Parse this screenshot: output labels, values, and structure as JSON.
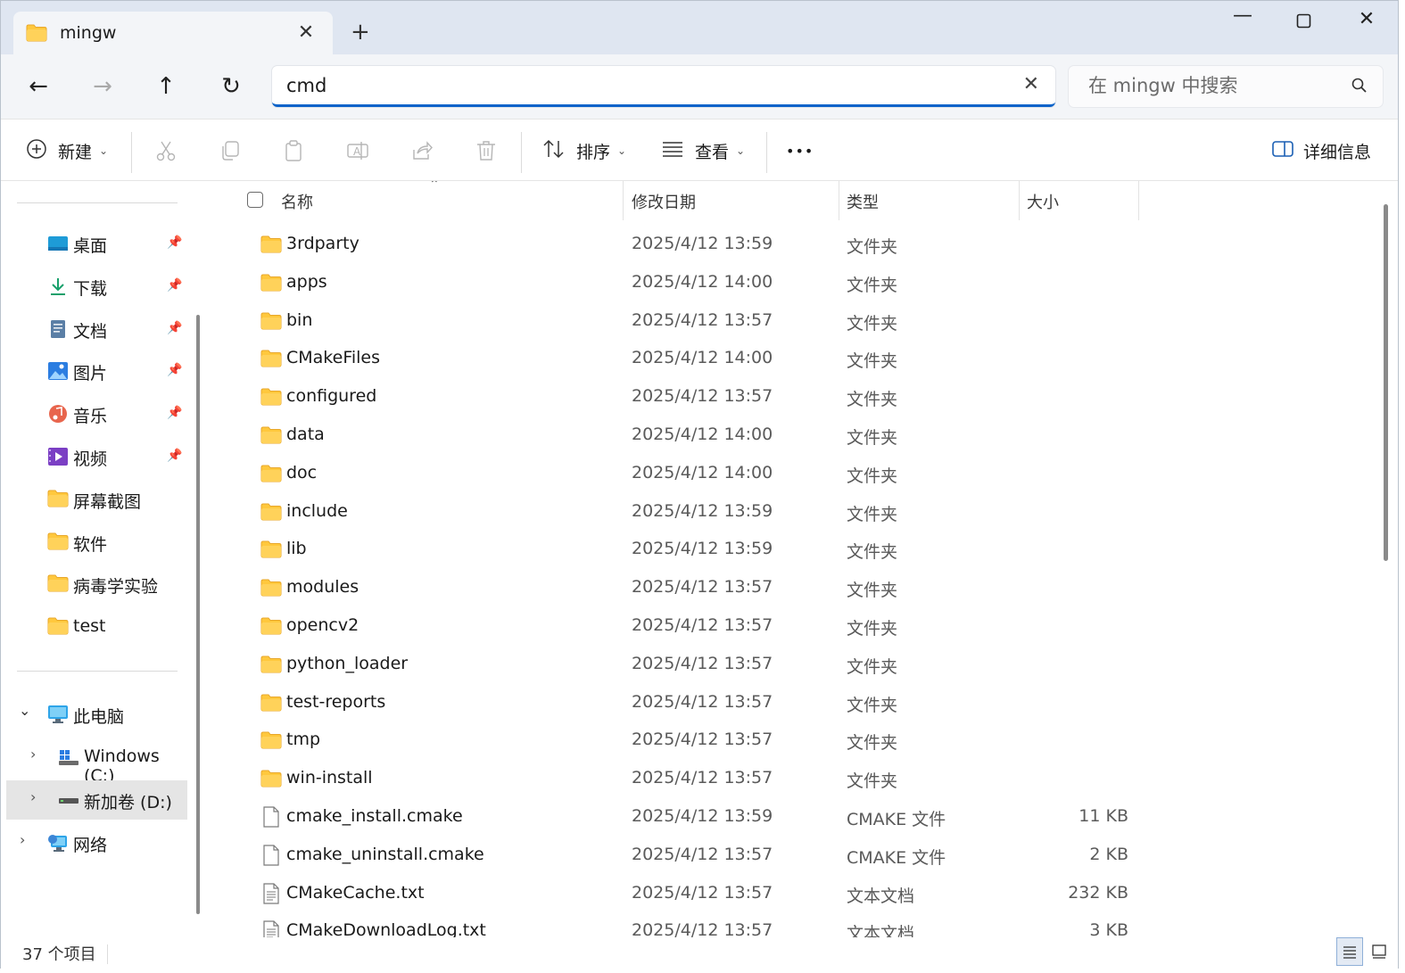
{
  "window": {
    "tab_title": "mingw",
    "new_tab": "+",
    "controls": {
      "minimize": "—",
      "maximize": "☐",
      "close": "✕"
    }
  },
  "nav": {
    "address_value": "cmd",
    "search_placeholder": "在 mingw 中搜索"
  },
  "toolbar": {
    "new_label": "新建",
    "sort_label": "排序",
    "view_label": "查看",
    "more_label": "•••",
    "details_label": "详细信息"
  },
  "sidebar": {
    "quick": [
      {
        "label": "桌面",
        "icon": "desktop-icon",
        "pinned": true
      },
      {
        "label": "下载",
        "icon": "download-icon",
        "pinned": true
      },
      {
        "label": "文档",
        "icon": "document-icon",
        "pinned": true
      },
      {
        "label": "图片",
        "icon": "pictures-icon",
        "pinned": true
      },
      {
        "label": "音乐",
        "icon": "music-icon",
        "pinned": true
      },
      {
        "label": "视频",
        "icon": "video-icon",
        "pinned": true
      },
      {
        "label": "屏幕截图",
        "icon": "folder-icon",
        "pinned": false
      },
      {
        "label": "软件",
        "icon": "folder-icon",
        "pinned": false
      },
      {
        "label": "病毒学实验",
        "icon": "folder-icon",
        "pinned": false
      },
      {
        "label": "test",
        "icon": "folder-icon",
        "pinned": false
      }
    ],
    "this_pc": "此电脑",
    "drive_c": "Windows (C:)",
    "drive_d": "新加卷 (D:)",
    "network": "网络"
  },
  "columns": {
    "name": "名称",
    "date": "修改日期",
    "type": "类型",
    "size": "大小"
  },
  "files": [
    {
      "name": "3rdparty",
      "date": "2025/4/12 13:59",
      "type": "文件夹",
      "size": "",
      "kind": "folder"
    },
    {
      "name": "apps",
      "date": "2025/4/12 14:00",
      "type": "文件夹",
      "size": "",
      "kind": "folder"
    },
    {
      "name": "bin",
      "date": "2025/4/12 13:57",
      "type": "文件夹",
      "size": "",
      "kind": "folder"
    },
    {
      "name": "CMakeFiles",
      "date": "2025/4/12 14:00",
      "type": "文件夹",
      "size": "",
      "kind": "folder"
    },
    {
      "name": "configured",
      "date": "2025/4/12 13:57",
      "type": "文件夹",
      "size": "",
      "kind": "folder"
    },
    {
      "name": "data",
      "date": "2025/4/12 14:00",
      "type": "文件夹",
      "size": "",
      "kind": "folder"
    },
    {
      "name": "doc",
      "date": "2025/4/12 14:00",
      "type": "文件夹",
      "size": "",
      "kind": "folder"
    },
    {
      "name": "include",
      "date": "2025/4/12 13:59",
      "type": "文件夹",
      "size": "",
      "kind": "folder"
    },
    {
      "name": "lib",
      "date": "2025/4/12 13:59",
      "type": "文件夹",
      "size": "",
      "kind": "folder"
    },
    {
      "name": "modules",
      "date": "2025/4/12 13:57",
      "type": "文件夹",
      "size": "",
      "kind": "folder"
    },
    {
      "name": "opencv2",
      "date": "2025/4/12 13:57",
      "type": "文件夹",
      "size": "",
      "kind": "folder"
    },
    {
      "name": "python_loader",
      "date": "2025/4/12 13:57",
      "type": "文件夹",
      "size": "",
      "kind": "folder"
    },
    {
      "name": "test-reports",
      "date": "2025/4/12 13:57",
      "type": "文件夹",
      "size": "",
      "kind": "folder"
    },
    {
      "name": "tmp",
      "date": "2025/4/12 13:57",
      "type": "文件夹",
      "size": "",
      "kind": "folder"
    },
    {
      "name": "win-install",
      "date": "2025/4/12 13:57",
      "type": "文件夹",
      "size": "",
      "kind": "folder"
    },
    {
      "name": "cmake_install.cmake",
      "date": "2025/4/12 13:59",
      "type": "CMAKE 文件",
      "size": "11 KB",
      "kind": "file"
    },
    {
      "name": "cmake_uninstall.cmake",
      "date": "2025/4/12 13:57",
      "type": "CMAKE 文件",
      "size": "2 KB",
      "kind": "file"
    },
    {
      "name": "CMakeCache.txt",
      "date": "2025/4/12 13:57",
      "type": "文本文档",
      "size": "232 KB",
      "kind": "text"
    },
    {
      "name": "CMakeDownloadLog.txt",
      "date": "2025/4/12 13:57",
      "type": "文本文档",
      "size": "3 KB",
      "kind": "text"
    }
  ],
  "status": {
    "item_count": "37 个项目"
  },
  "colors": {
    "accent": "#0a63c9",
    "folder": "#ffc83d",
    "folder_dark": "#e8a72a",
    "titlebar": "#dfe6f1"
  }
}
